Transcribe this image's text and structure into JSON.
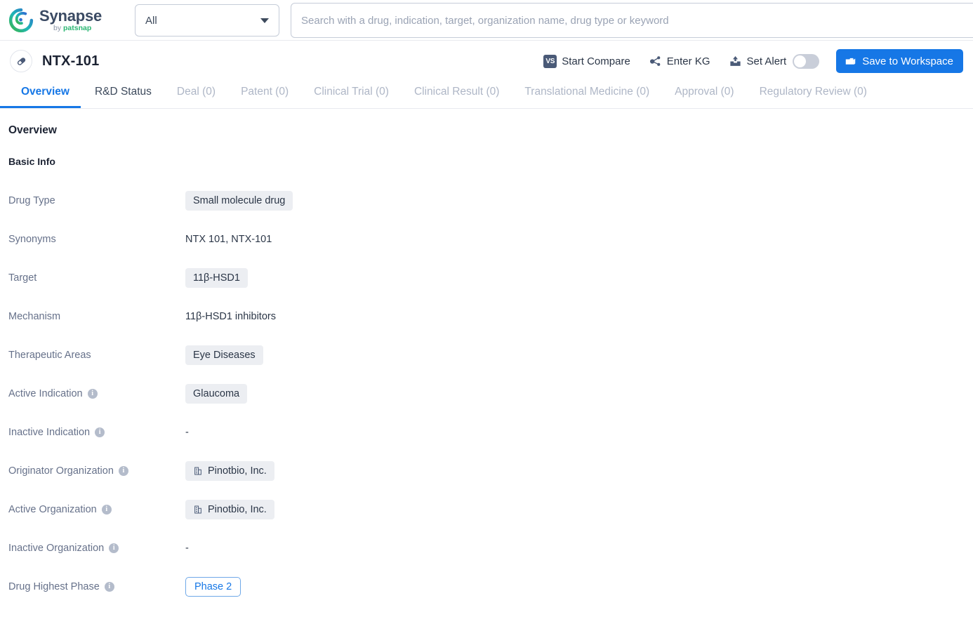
{
  "brand": {
    "name": "Synapse",
    "by": "by ",
    "by_brand": "patsnap",
    "logo_icon": "synapse-swirl-logo"
  },
  "search": {
    "scope_value": "All",
    "scope_caret_icon": "chevron-down-icon",
    "placeholder": "Search with a drug, indication, target, organization name, drug type or keyword",
    "value": ""
  },
  "drug_header": {
    "icon": "pill-capsule-icon",
    "title": "NTX-101",
    "actions": [
      {
        "label": "Start Compare",
        "icon": "vs-icon"
      },
      {
        "label": "Enter KG",
        "icon": "knowledge-graph-icon"
      },
      {
        "label": "Set Alert",
        "icon": "alert-tray-icon",
        "toggle_on": false
      }
    ],
    "save_button": {
      "label": "Save to Workspace",
      "icon": "folder-icon",
      "color": "#1677e6"
    }
  },
  "tabs": [
    {
      "label": "Overview",
      "state": "active"
    },
    {
      "label": "R&D Status",
      "state": "semi"
    },
    {
      "label": "Deal (0)",
      "state": "muted"
    },
    {
      "label": "Patent (0)",
      "state": "muted"
    },
    {
      "label": "Clinical Trial (0)",
      "state": "muted"
    },
    {
      "label": "Clinical Result (0)",
      "state": "muted"
    },
    {
      "label": "Translational Medicine (0)",
      "state": "muted"
    },
    {
      "label": "Approval (0)",
      "state": "muted"
    },
    {
      "label": "Regulatory Review (0)",
      "state": "muted"
    }
  ],
  "overview": {
    "heading": "Overview",
    "basic_info_heading": "Basic Info",
    "rows": [
      {
        "label": "Drug Type",
        "has_info": false,
        "type": "chip",
        "value": "Small molecule drug"
      },
      {
        "label": "Synonyms",
        "has_info": false,
        "type": "text",
        "value": "NTX 101,  NTX-101"
      },
      {
        "label": "Target",
        "has_info": false,
        "type": "chip",
        "value": "11β-HSD1"
      },
      {
        "label": "Mechanism",
        "has_info": false,
        "type": "text",
        "value": "11β-HSD1 inhibitors"
      },
      {
        "label": "Therapeutic Areas",
        "has_info": false,
        "type": "chip",
        "value": "Eye Diseases"
      },
      {
        "label": "Active Indication",
        "has_info": true,
        "type": "chip",
        "value": "Glaucoma"
      },
      {
        "label": "Inactive Indication",
        "has_info": true,
        "type": "dash",
        "value": "-"
      },
      {
        "label": "Originator Organization",
        "has_info": true,
        "type": "org",
        "value": "Pinotbio, Inc.",
        "icon": "building-icon"
      },
      {
        "label": "Active Organization",
        "has_info": true,
        "type": "org",
        "value": "Pinotbio, Inc.",
        "icon": "building-icon"
      },
      {
        "label": "Inactive Organization",
        "has_info": true,
        "type": "dash",
        "value": "-"
      },
      {
        "label": "Drug Highest Phase",
        "has_info": true,
        "type": "phase",
        "value": "Phase 2"
      }
    ],
    "info_glyph": "i"
  },
  "colors": {
    "accent": "#1677e6",
    "chip_bg": "#eceef2",
    "label": "#66718a",
    "muted_tab": "#aeb6c6"
  }
}
